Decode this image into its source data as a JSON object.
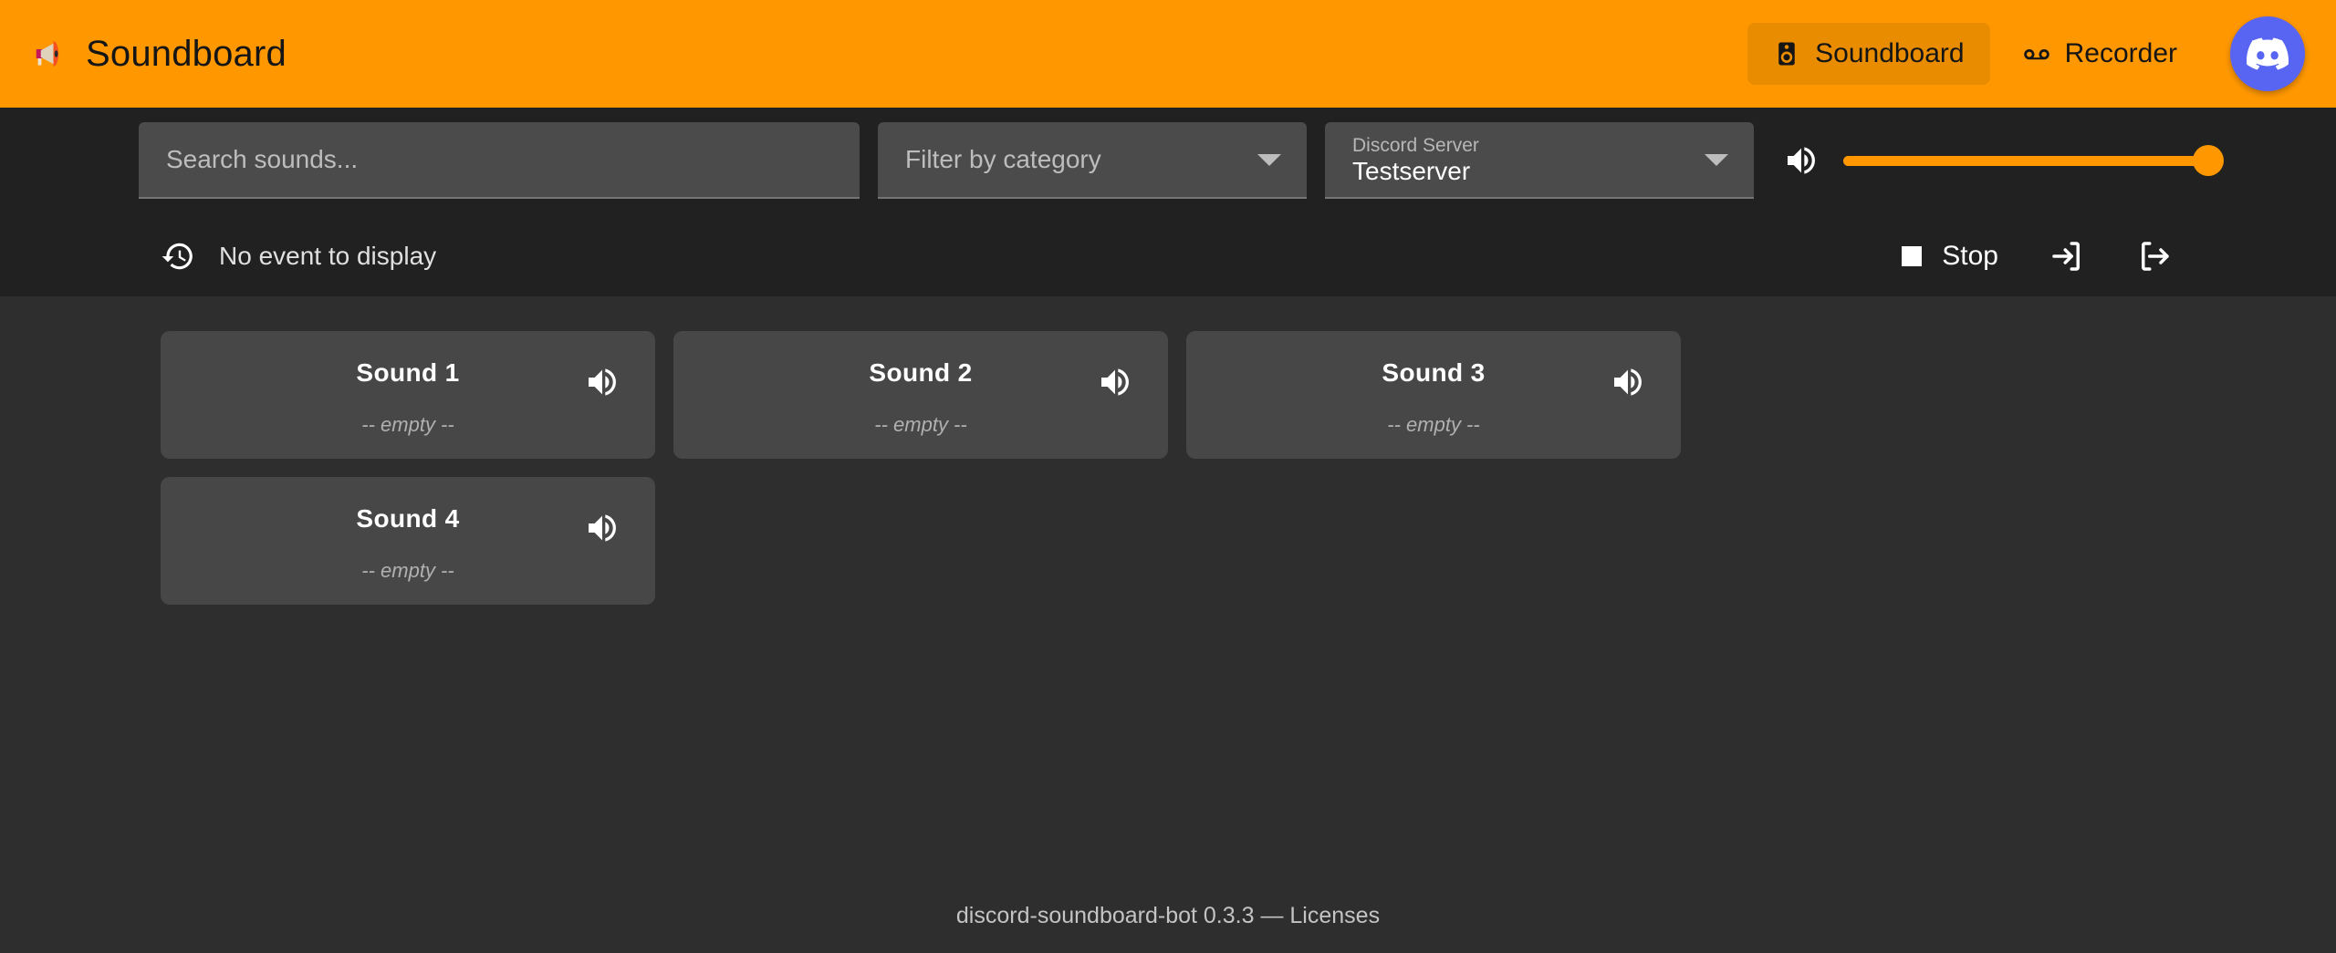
{
  "header": {
    "brand_icon": "megaphone-emoji",
    "title": "Soundboard",
    "nav": [
      {
        "label": "Soundboard",
        "icon": "speaker-box-icon",
        "active": true
      },
      {
        "label": "Recorder",
        "icon": "voicemail-icon",
        "active": false
      }
    ],
    "discord_button": {
      "icon": "discord-logo-icon",
      "color": "#5865F2"
    },
    "background_color": "#FF9800",
    "active_tab_color": "#E98C00"
  },
  "toolbar": {
    "search": {
      "placeholder": "Search sounds...",
      "value": ""
    },
    "category_filter": {
      "placeholder": "Filter by category",
      "value": "",
      "caret_icon": "chevron-down-icon"
    },
    "server_select": {
      "label": "Discord Server",
      "value": "Testserver",
      "caret_icon": "chevron-down-icon"
    },
    "volume": {
      "icon": "volume-up-icon",
      "value": 100,
      "min": 0,
      "max": 100,
      "accent_color": "#FF9800"
    },
    "event": {
      "icon": "history-icon",
      "text": "No event to display"
    },
    "actions": {
      "stop_label": "Stop",
      "stop_icon": "stop-square-icon",
      "join_icon": "login-arrow-icon",
      "leave_icon": "logout-arrow-icon"
    },
    "background_color": "#212121"
  },
  "main": {
    "background_color": "#2e2e2e",
    "sounds": [
      {
        "title": "Sound 1",
        "subtitle": "-- empty --",
        "volume_icon": "volume-up-icon"
      },
      {
        "title": "Sound 2",
        "subtitle": "-- empty --",
        "volume_icon": "volume-up-icon"
      },
      {
        "title": "Sound 3",
        "subtitle": "-- empty --",
        "volume_icon": "volume-up-icon"
      },
      {
        "title": "Sound 4",
        "subtitle": "-- empty --",
        "volume_icon": "volume-up-icon"
      }
    ]
  },
  "footer": {
    "app_version_text": "discord-soundboard-bot 0.3.3 — ",
    "licenses_link": "Licenses"
  }
}
